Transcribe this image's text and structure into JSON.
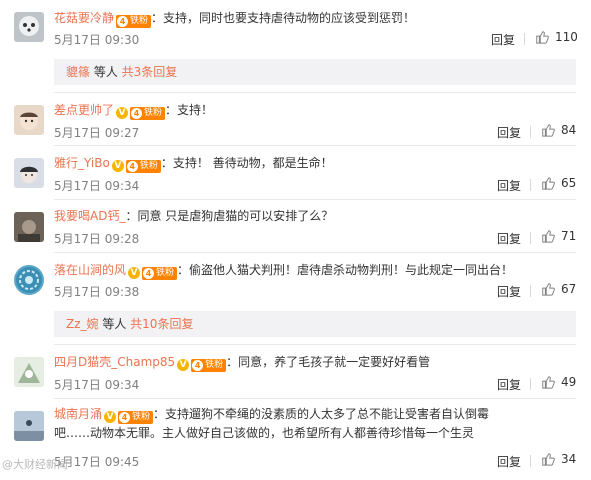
{
  "comments": [
    {
      "user": "花菇要冷静",
      "badges": {
        "v": false,
        "fan_level": "4",
        "fan_label": "铁粉"
      },
      "text": "：支持，同时也要支持虐待动物的应该受到惩罚！",
      "time": "5月17日 09:30",
      "reply": "回复",
      "likes": "110",
      "avatar_color": "#bfc4c9"
    },
    {
      "user": "差点更帅了",
      "badges": {
        "v": true,
        "fan_level": "4",
        "fan_label": "铁粉"
      },
      "text": "：支持！",
      "time": "5月17日 09:27",
      "reply": "回复",
      "likes": "84",
      "avatar_color": "#e8d8c8"
    },
    {
      "user": "雅行_YiBo",
      "badges": {
        "v": true,
        "fan_level": "4",
        "fan_label": "铁粉"
      },
      "text": "：支持！ 善待动物，都是生命！",
      "time": "5月17日 09:34",
      "reply": "回复",
      "likes": "65",
      "avatar_color": "#d9dde6"
    },
    {
      "user": "我要喝AD钙_",
      "badges": {
        "v": false,
        "fan_level": "",
        "fan_label": ""
      },
      "text": "：同意 只是虐狗虐猫的可以安排了么？",
      "time": "5月17日 09:28",
      "reply": "回复",
      "likes": "71",
      "avatar_color": "#8a7a6a"
    },
    {
      "user": "落在山涧的风",
      "badges": {
        "v": true,
        "fan_level": "4",
        "fan_label": "铁粉"
      },
      "text": "：偷盗他人猫犬判刑！虐待虐杀动物判刑！与此规定一同出台！",
      "time": "5月17日 09:38",
      "reply": "回复",
      "likes": "67",
      "avatar_color": "#5aa7c7"
    },
    {
      "user": "四月D猫壳_Champ85",
      "badges": {
        "v": true,
        "fan_level": "4",
        "fan_label": "铁粉"
      },
      "text": "：同意，养了毛孩子就一定要好好看管",
      "time": "5月17日 09:34",
      "reply": "回复",
      "likes": "49",
      "avatar_color": "#c9d6c4"
    },
    {
      "user": "城南月涌",
      "badges": {
        "v": true,
        "fan_level": "4",
        "fan_label": "铁粉"
      },
      "text": "：支持遛狗不牵绳的没素质的人太多了总不能让受害者自认倒霉吧……动物本无罪。主人做好自己该做的，也希望所有人都善待珍惜每一个生灵",
      "time": "5月17日 09:45",
      "reply": "回复",
      "likes": "34",
      "avatar_color": "#9ab0c8"
    }
  ],
  "sub_replies": [
    {
      "user": "貔篠",
      "text": " 等人 ",
      "more": "共3条回复"
    },
    {
      "user": "Zz_婉",
      "text": " 等人 ",
      "more": "共10条回复"
    }
  ],
  "watermark": "@大财经新闻",
  "colors": {
    "username": "#eb7350",
    "fan_badge": "#ff8200",
    "v_badge": "#f7b500",
    "sub_bg": "#f2f2f5"
  }
}
